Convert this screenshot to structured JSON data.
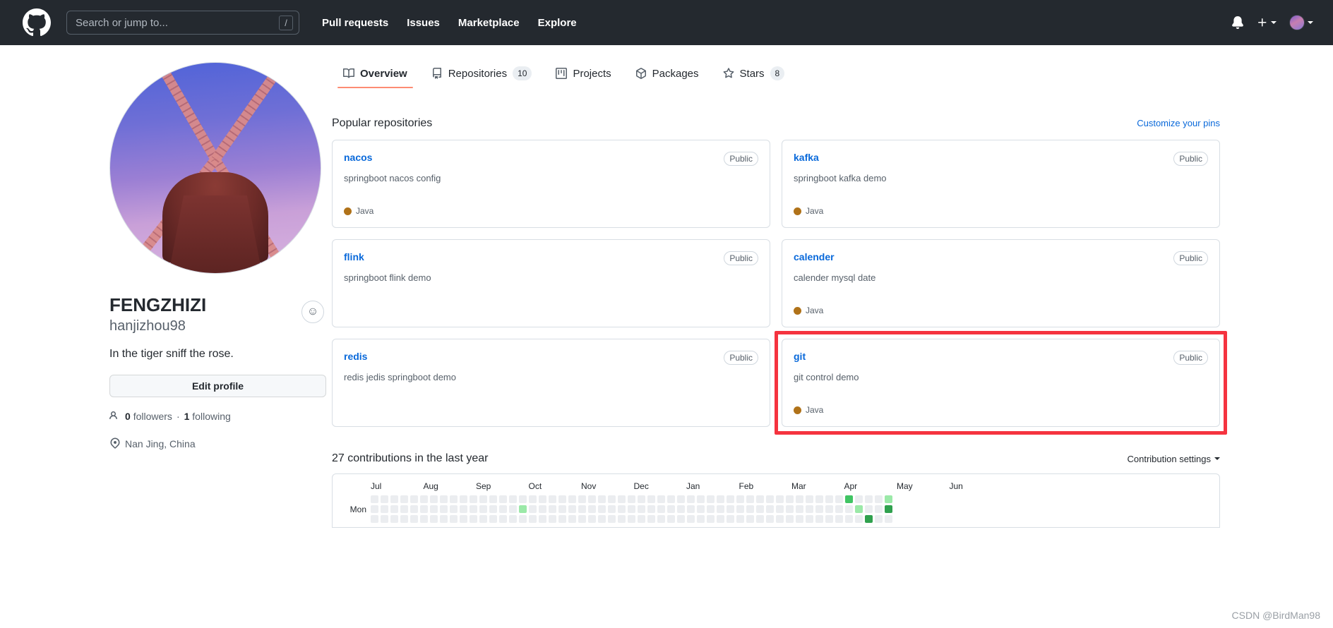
{
  "header": {
    "logo_icon": "github-mark-icon",
    "search": {
      "placeholder": "Search or jump to...",
      "value": "",
      "shortcut_key": "/"
    },
    "nav": [
      {
        "label": "Pull requests"
      },
      {
        "label": "Issues"
      },
      {
        "label": "Marketplace"
      },
      {
        "label": "Explore"
      }
    ],
    "notifications_icon": "bell-icon",
    "create_new_icon": "plus-icon",
    "create_new_caret": "chevron-down-icon",
    "avatar_icon": "user-avatar",
    "avatar_caret": "chevron-down-icon",
    "background": "#24292f"
  },
  "profile": {
    "avatar_alt": "windmill-avatar",
    "emoji_button_icon": "smiley-icon",
    "name": "FENGZHIZI",
    "login": "hanjizhou98",
    "bio": "In the tiger sniff the rose.",
    "edit_button": "Edit profile",
    "followers_count": "0",
    "followers_label": "followers",
    "separator": "·",
    "following_count": "1",
    "following_label": "following",
    "people_icon": "people-icon",
    "location_icon": "location-pin-icon",
    "location": "Nan Jing, China"
  },
  "tabs": [
    {
      "label": "Overview",
      "icon": "book-icon",
      "active": true,
      "count": null
    },
    {
      "label": "Repositories",
      "icon": "repo-icon",
      "active": false,
      "count": "10"
    },
    {
      "label": "Projects",
      "icon": "project-icon",
      "active": false,
      "count": null
    },
    {
      "label": "Packages",
      "icon": "package-icon",
      "active": false,
      "count": null
    },
    {
      "label": "Stars",
      "icon": "star-icon",
      "active": false,
      "count": "8"
    }
  ],
  "popular": {
    "title": "Popular repositories",
    "customize_link": "Customize your pins",
    "repos": [
      {
        "name": "nacos",
        "visibility": "Public",
        "description": "springboot nacos config",
        "language": "Java",
        "language_color": "#b07219",
        "highlighted": false
      },
      {
        "name": "kafka",
        "visibility": "Public",
        "description": "springboot kafka demo",
        "language": "Java",
        "language_color": "#b07219",
        "highlighted": false
      },
      {
        "name": "flink",
        "visibility": "Public",
        "description": "springboot flink demo",
        "language": "",
        "language_color": "#b07219",
        "highlighted": false
      },
      {
        "name": "calender",
        "visibility": "Public",
        "description": "calender mysql date",
        "language": "Java",
        "language_color": "#b07219",
        "highlighted": false
      },
      {
        "name": "redis",
        "visibility": "Public",
        "description": "redis jedis springboot demo",
        "language": "",
        "language_color": "#b07219",
        "highlighted": false
      },
      {
        "name": "git",
        "visibility": "Public",
        "description": "git control demo",
        "language": "Java",
        "language_color": "#b07219",
        "highlighted": true
      }
    ],
    "highlight_color": "#f5333f"
  },
  "contributions": {
    "title": "27 contributions in the last year",
    "settings_label": "Contribution settings",
    "settings_caret": "chevron-down-icon",
    "months": [
      "Jul",
      "Aug",
      "Sep",
      "Oct",
      "Nov",
      "Dec",
      "Jan",
      "Feb",
      "Mar",
      "Apr",
      "May",
      "Jun"
    ],
    "day_labels": [
      "",
      "Mon",
      ""
    ],
    "levels": {
      "0": "#ebedf0",
      "1": "#9be9a8",
      "2": "#40c463",
      "3": "#30a14e"
    },
    "chart_data": {
      "type": "heatmap",
      "title": "27 contributions in the last year",
      "xlabel": "",
      "ylabel": "",
      "weeks": 53,
      "visible_rows": 3,
      "highlighted_cells": [
        {
          "week": 15,
          "row": 1,
          "level": 1
        },
        {
          "week": 48,
          "row": 0,
          "level": 2
        },
        {
          "week": 49,
          "row": 1,
          "level": 1
        },
        {
          "week": 52,
          "row": 0,
          "level": 1
        },
        {
          "week": 52,
          "row": 1,
          "level": 3
        },
        {
          "week": 50,
          "row": 2,
          "level": 3
        }
      ]
    }
  },
  "watermark": "CSDN @BirdMan98"
}
